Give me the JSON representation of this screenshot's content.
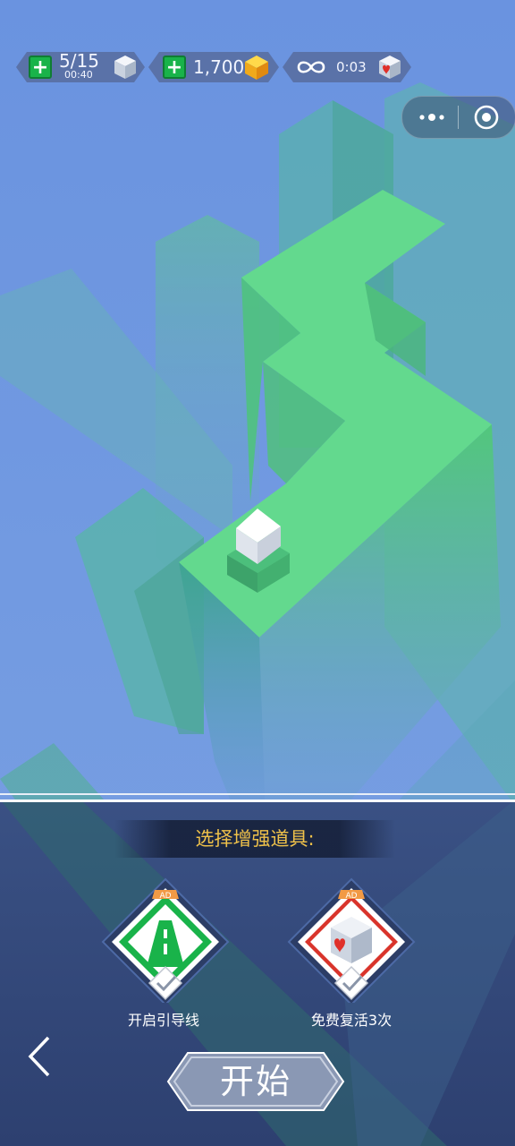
{
  "hud": {
    "lives": {
      "value": "5/15",
      "timer": "00:40",
      "icon": "cube-icon"
    },
    "coins": {
      "value": "1,700",
      "icon": "gold-cube-icon"
    },
    "revive": {
      "icon": "infinity-icon",
      "timer": "0:03",
      "badge_icon": "heart-cube-icon"
    }
  },
  "miniprogram": {
    "menu_icon": "more-dots-icon",
    "close_icon": "target-close-icon"
  },
  "panel": {
    "title": "选择增强道具:",
    "powerups": [
      {
        "label": "开启引导线",
        "badge": "AD",
        "icon": "road-guide-icon",
        "checked": true,
        "color": "#19b34a"
      },
      {
        "label": "免费复活3次",
        "badge": "AD",
        "icon": "heart-cube-icon",
        "checked": true,
        "color": "#d9342b"
      }
    ],
    "back_icon": "chevron-left-icon",
    "start_label": "开始"
  },
  "colors": {
    "sky": "#6f98df",
    "path_green": "#5fd28a",
    "panel": "#34497a",
    "banner_text": "#f0c24a"
  }
}
